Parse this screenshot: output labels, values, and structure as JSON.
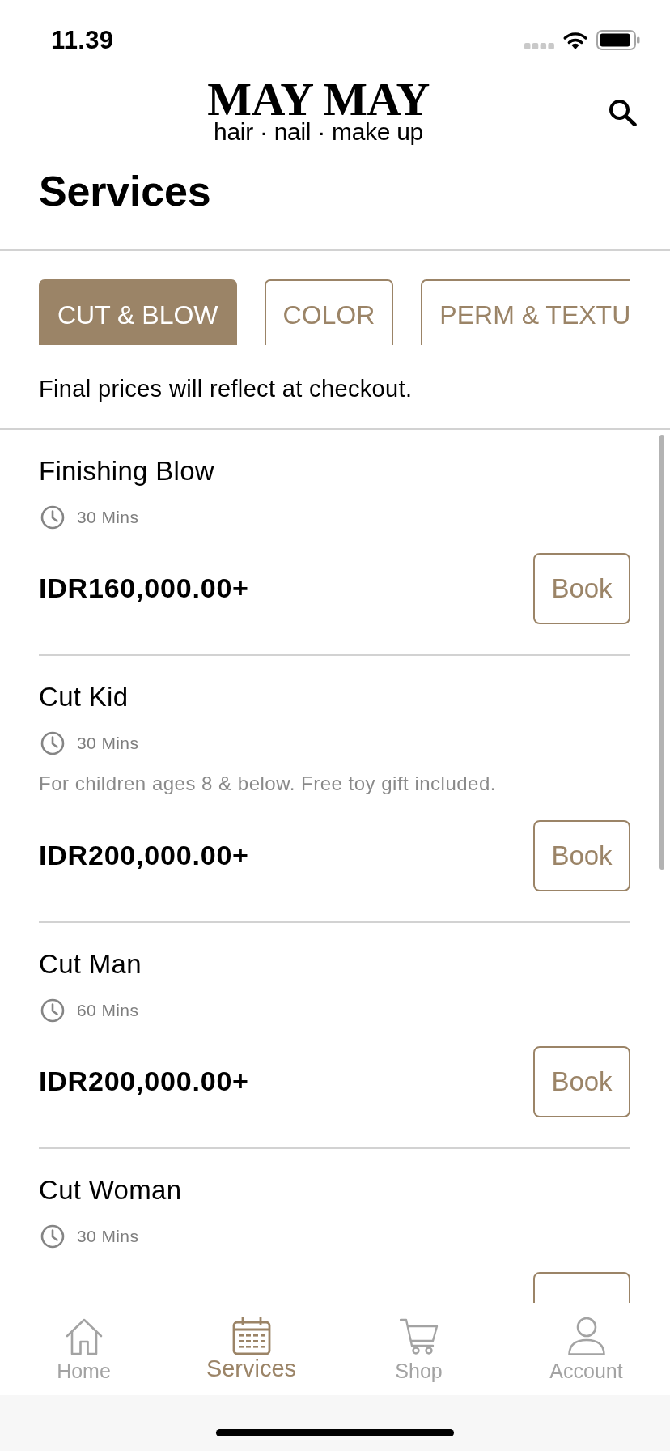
{
  "status_bar": {
    "time": "11.39"
  },
  "header": {
    "brand": "MAY MAY",
    "tagline": "hair · nail · make up"
  },
  "title": "Services",
  "categories": [
    {
      "label": "CUT & BLOW",
      "selected": true
    },
    {
      "label": "COLOR",
      "selected": false
    },
    {
      "label": "PERM & TEXTU",
      "selected": false
    }
  ],
  "note": "Final prices will reflect at checkout.",
  "services": [
    {
      "name": "Finishing Blow",
      "duration": "30 Mins",
      "price": "IDR160,000.00+",
      "button": "Book"
    },
    {
      "name": "Cut Kid",
      "duration": "30 Mins",
      "description": "For children ages 8 & below. Free toy gift included.",
      "price": "IDR200,000.00+",
      "button": "Book"
    },
    {
      "name": "Cut Man",
      "duration": "60 Mins",
      "price": "IDR200,000.00+",
      "button": "Book"
    },
    {
      "name": "Cut Woman",
      "duration": "30 Mins"
    }
  ],
  "bottom_nav": [
    {
      "label": "Home",
      "selected": false
    },
    {
      "label": "Services",
      "selected": true
    },
    {
      "label": "Shop",
      "selected": false
    },
    {
      "label": "Account",
      "selected": false
    }
  ]
}
